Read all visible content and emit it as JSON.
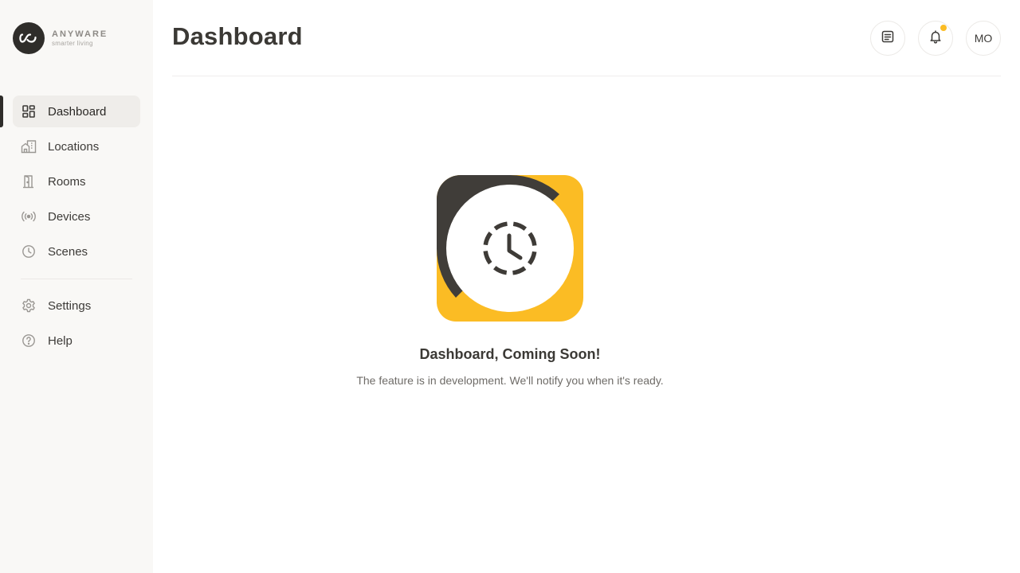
{
  "brand": {
    "name": "ANYWARE",
    "tagline": "smarter living"
  },
  "sidebar": {
    "items": [
      {
        "label": "Dashboard",
        "icon": "dashboard-grid-icon",
        "active": true
      },
      {
        "label": "Locations",
        "icon": "buildings-icon"
      },
      {
        "label": "Rooms",
        "icon": "door-icon"
      },
      {
        "label": "Devices",
        "icon": "broadcast-icon"
      },
      {
        "label": "Scenes",
        "icon": "clock-icon"
      }
    ],
    "footer_items": [
      {
        "label": "Settings",
        "icon": "gear-icon"
      },
      {
        "label": "Help",
        "icon": "help-circle-icon"
      }
    ]
  },
  "header": {
    "title": "Dashboard",
    "actions": [
      {
        "icon": "notes-icon"
      },
      {
        "icon": "bell-icon",
        "has_notification": true
      },
      {
        "label": "MO"
      }
    ]
  },
  "main": {
    "empty_state": {
      "illustration": "clock-icon",
      "title": "Dashboard, Coming Soon!",
      "subtitle": "The feature is in development. We'll notify you when it's ready."
    }
  },
  "colors": {
    "accent": "#fbbc24",
    "dark": "#3e3b37",
    "sidebar_bg": "#f9f8f6"
  }
}
